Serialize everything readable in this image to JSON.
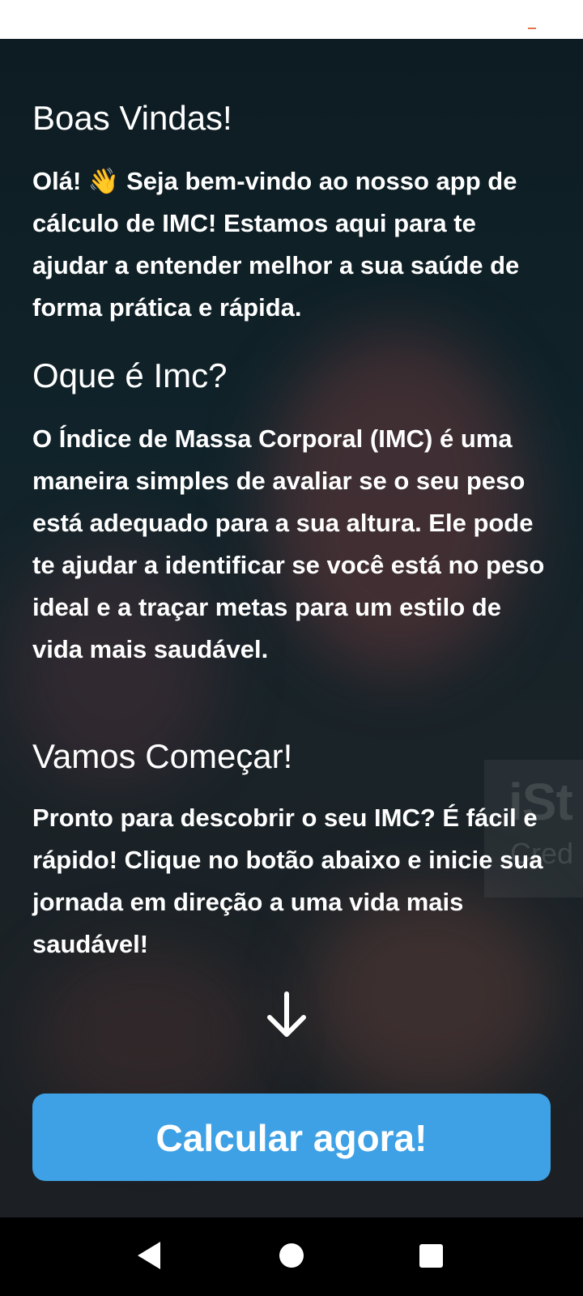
{
  "welcome": {
    "title": "Boas Vindas!",
    "text": "Olá! 👋 Seja bem-vindo ao nosso app de cálculo de IMC! Estamos aqui para te ajudar a entender melhor a sua saúde de forma prática e rápida."
  },
  "about": {
    "title": "Oque é Imc?",
    "text": "O Índice de Massa Corporal (IMC) é uma maneira simples de avaliar se o seu peso está adequado para a sua altura. Ele pode te ajudar a identificar se você está no peso ideal e a traçar metas para um estilo de vida mais saudável."
  },
  "start": {
    "title": "Vamos Começar!",
    "text": "Pronto para descobrir o seu IMC? É fácil e rápido! Clique no botão abaixo e inicie sua jornada em direção a uma vida mais saudável!"
  },
  "cta": {
    "label": "Calcular agora!"
  },
  "watermark": {
    "main": "iSt",
    "sub": "Cred"
  },
  "icons": {
    "arrow": "arrow-down-icon",
    "nav_back": "back-triangle-icon",
    "nav_home": "home-circle-icon",
    "nav_recent": "recents-square-icon"
  },
  "colors": {
    "button": "#3ea1e6",
    "background": "#11232a",
    "text": "#ffffff",
    "status_accent": "#e8734a"
  }
}
